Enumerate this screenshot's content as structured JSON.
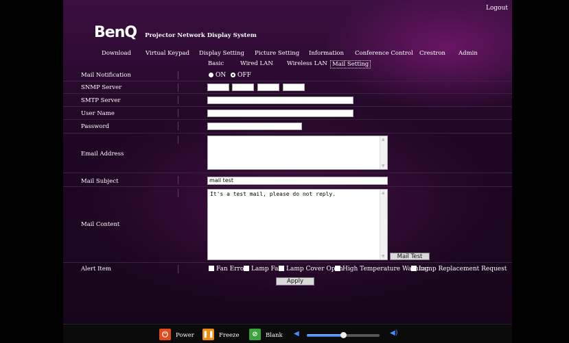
{
  "header": {
    "logout": "Logout",
    "logo": "BenQ",
    "system_name": "Projector Network Display System"
  },
  "topnav": [
    "Download",
    "Virtual Keypad",
    "Display Setting",
    "Picture Setting",
    "Information",
    "Conference Control",
    "Crestron",
    "Admin"
  ],
  "subnav": [
    "Basic",
    "Wired LAN",
    "Wireless LAN",
    "Mail Setting"
  ],
  "subnav_active": "Mail Setting",
  "form": {
    "mail_notification": {
      "label": "Mail Notification",
      "on": "ON",
      "off": "OFF",
      "selected": "OFF"
    },
    "snmp_server": {
      "label": "SNMP Server",
      "octets": [
        "",
        "",
        "",
        ""
      ]
    },
    "smtp_server": {
      "label": "SMTP Server",
      "value": ""
    },
    "user_name": {
      "label": "User Name",
      "value": ""
    },
    "password": {
      "label": "Password",
      "value": ""
    },
    "email_address": {
      "label": "Email Address",
      "value": ""
    },
    "mail_subject": {
      "label": "Mail Subject",
      "value": "mail test"
    },
    "mail_content": {
      "label": "Mail Content",
      "value": "It's a test mail, please do not reply."
    },
    "mail_test_button": "Mail Test",
    "alert_item": {
      "label": "Alert Item",
      "options": [
        "Fan Error",
        "Lamp Fail",
        "Lamp Cover Open",
        "High Temperature Warning",
        "Lamp Replacement Request"
      ]
    },
    "apply_button": "Apply"
  },
  "bottombar": {
    "power": "Power",
    "freeze": "Freeze",
    "blank": "Blank",
    "volume_fraction": 0.5,
    "colors": {
      "power": "#e24a1b",
      "freeze": "#f28a12",
      "blank": "#3aa43a",
      "volume": "#2f6fe0"
    }
  }
}
